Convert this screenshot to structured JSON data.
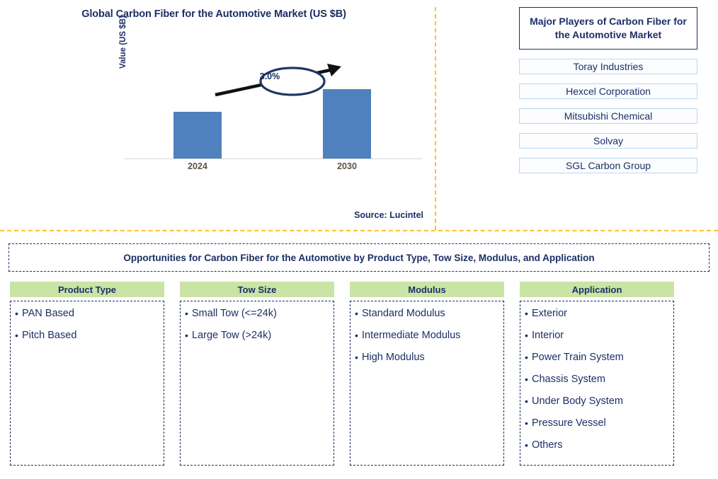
{
  "chart_panel": {
    "title": "Global Carbon Fiber for the Automotive Market (US $B)",
    "source": "Source: Lucintel"
  },
  "chart_data": {
    "type": "bar",
    "title": "Global Carbon Fiber for the Automotive Market (US $B)",
    "xlabel": "",
    "ylabel": "Value (US $B)",
    "categories": [
      "2024",
      "2030"
    ],
    "values": [
      66,
      98
    ],
    "value_unit": "relative bar height (no axis scale shown)",
    "annotation": "3.0%",
    "annotation_meaning": "CAGR 2024-2030",
    "grid": false,
    "legend": "none",
    "bar_color": "#4E81BD"
  },
  "players": {
    "header": "Major Players of Carbon Fiber for the Automotive Market",
    "items": [
      "Toray Industries",
      "Hexcel Corporation",
      "Mitsubishi Chemical",
      "Solvay",
      "SGL Carbon Group"
    ]
  },
  "opportunities": {
    "banner": "Opportunities for Carbon Fiber for the Automotive by Product Type, Tow Size, Modulus, and Application",
    "bullet": "•",
    "columns": [
      {
        "header": "Product Type",
        "items": [
          "PAN Based",
          "Pitch Based"
        ]
      },
      {
        "header": "Tow Size",
        "items": [
          "Small Tow (<=24k)",
          "Large Tow (>24k)"
        ]
      },
      {
        "header": "Modulus",
        "items": [
          "Standard Modulus",
          "Intermediate Modulus",
          "High Modulus"
        ]
      },
      {
        "header": "Application",
        "items": [
          "Exterior",
          "Interior",
          "Power Train System",
          "Chassis System",
          "Under Body System",
          "Pressure Vessel",
          "Others"
        ]
      }
    ]
  },
  "colors": {
    "navy": "#1B2F66",
    "bar_blue": "#4E81BD",
    "header_green": "#C9E4A4",
    "divider_gold": "#FBC02D",
    "player_border": "#BDD7EE"
  }
}
